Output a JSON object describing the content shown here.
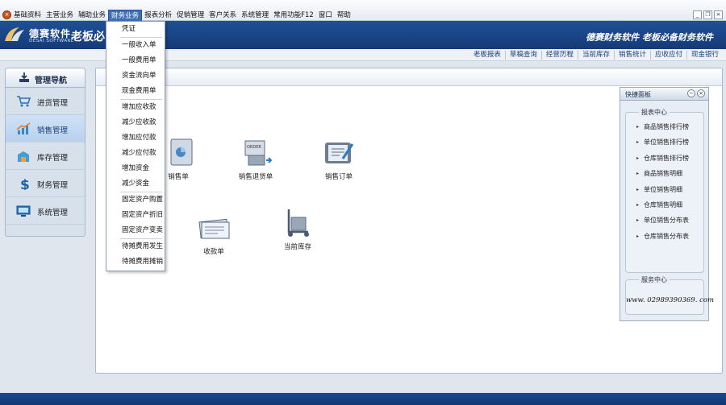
{
  "menubar": {
    "items": [
      "基础资料",
      "主营业务",
      "辅助业务",
      "财务业务",
      "报表分析",
      "促销管理",
      "客户关系",
      "系统管理",
      "常用功能F12",
      "窗口",
      "帮助"
    ],
    "active_index": 3
  },
  "banner": {
    "logo_name": "德赛软件",
    "logo_sub": "DESAI SOFTWARE",
    "title": "老板必",
    "slogan": "德赛财务软件 老板必备财务软件"
  },
  "quicklinks": [
    "老板报表",
    "草稿查询",
    "经营历程",
    "当前库存",
    "销售统计",
    "应收应付",
    "现金银行"
  ],
  "nav": {
    "title": "管理导航",
    "items": [
      {
        "label": "进货管理",
        "icon": "cart-icon"
      },
      {
        "label": "销售管理",
        "icon": "sales-chart-icon"
      },
      {
        "label": "库存管理",
        "icon": "warehouse-icon"
      },
      {
        "label": "财务管理",
        "icon": "dollar-icon"
      },
      {
        "label": "系统管理",
        "icon": "monitor-icon"
      }
    ],
    "selected_index": 1
  },
  "functions": [
    {
      "label": "销售单",
      "icon": "sales-doc-icon"
    },
    {
      "label": "销售退货单",
      "icon": "return-order-icon"
    },
    {
      "label": "销售订单",
      "icon": "sales-order-icon"
    },
    {
      "label": "收款单",
      "icon": "receipt-icon"
    },
    {
      "label": "当前库存",
      "icon": "hand-truck-icon"
    }
  ],
  "dropdown": {
    "groups": [
      [
        "凭证"
      ],
      [
        "一般收入单",
        "一般费用单",
        "资金流向单",
        "现金费用单"
      ],
      [
        "增加应收款",
        "减少应收款",
        "增加应付款",
        "减少应付款",
        "增加资金",
        "减少资金"
      ],
      [
        "固定资产购置",
        "固定资产折旧",
        "固定资产变卖"
      ],
      [
        "待摊费用发生",
        "待摊费用摊销"
      ]
    ]
  },
  "quick_panel": {
    "title": "快捷面板",
    "reports_label": "报表中心",
    "reports": [
      "商品销售排行榜",
      "单位销售排行榜",
      "仓库销售排行榜",
      "商品销售明细",
      "单位销售明细",
      "仓库销售明细",
      "单位销售分布表",
      "仓库销售分布表"
    ],
    "service_label": "服务中心",
    "phone": "www. 02989390369. com"
  },
  "colors": {
    "banner": "#1a468a",
    "menu_active": "#3d6fb3",
    "link": "#1a3f7a"
  }
}
